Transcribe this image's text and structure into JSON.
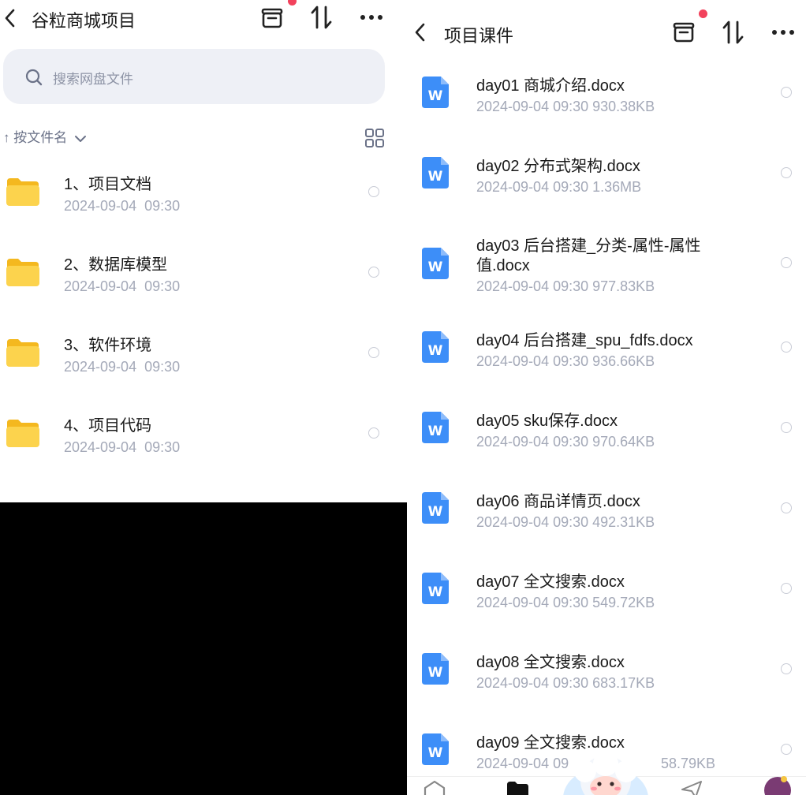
{
  "left": {
    "title": "谷粒商城项目",
    "search_placeholder": "搜索网盘文件",
    "sort_label": "↑ 按文件名",
    "items": [
      {
        "name": "1、项目文档",
        "date": "2024-09-04",
        "time": "09:30"
      },
      {
        "name": "2、数据库模型",
        "date": "2024-09-04",
        "time": "09:30"
      },
      {
        "name": "3、软件环境",
        "date": "2024-09-04",
        "time": "09:30"
      },
      {
        "name": "4、项目代码",
        "date": "2024-09-04",
        "time": "09:30"
      }
    ]
  },
  "right": {
    "title": "项目课件",
    "files": [
      {
        "name": "day01 商城介绍.docx",
        "name2": "",
        "meta": "2024-09-04  09:30  930.38KB"
      },
      {
        "name": "day02 分布式架构.docx",
        "name2": "",
        "meta": "2024-09-04  09:30  1.36MB"
      },
      {
        "name": "day03 后台搭建_分类-属性-属性",
        "name2": "值.docx",
        "meta": "2024-09-04  09:30  977.83KB"
      },
      {
        "name": "day04 后台搭建_spu_fdfs.docx",
        "name2": "",
        "meta": "2024-09-04  09:30  936.66KB"
      },
      {
        "name": "day05 sku保存.docx",
        "name2": "",
        "meta": "2024-09-04  09:30  970.64KB"
      },
      {
        "name": "day06 商品详情页.docx",
        "name2": "",
        "meta": "2024-09-04  09:30  492.31KB"
      },
      {
        "name": "day07 全文搜索.docx",
        "name2": "",
        "meta": "2024-09-04  09:30  549.72KB"
      },
      {
        "name": "day08 全文搜索.docx",
        "name2": "",
        "meta": "2024-09-04  09:30  683.17KB"
      },
      {
        "name": "day09 全文搜索.docx",
        "name2": "",
        "meta": "2024-09-04  09"
      },
      {
        "name": "",
        "name2": "",
        "meta": "58.79KB"
      }
    ]
  },
  "icons": {
    "back": "chevron-left-icon",
    "transfer": "transfer-box-icon",
    "sort": "sort-arrows-icon",
    "more": "more-dots-icon",
    "search": "search-icon",
    "grid": "grid-view-icon",
    "folder": "folder-icon",
    "word": "word-doc-icon",
    "radio": "select-circle-icon"
  },
  "colors": {
    "accent_red": "#f2425c",
    "folder_yellow": "#fbd147",
    "word_blue": "#3d8ef8",
    "meta_gray": "#a4a9b8"
  }
}
